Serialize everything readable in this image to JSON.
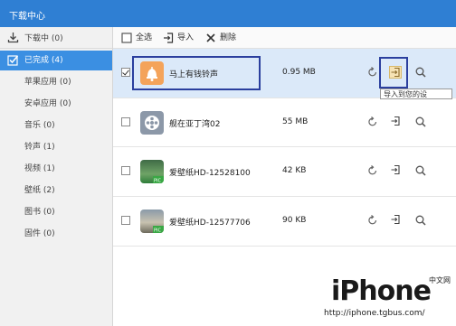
{
  "window": {
    "title": "下载中心"
  },
  "sidebar": {
    "downloading": "下载中 (0)",
    "done": "已完成 (4)",
    "categories": [
      "苹果应用 (0)",
      "安卓应用 (0)",
      "音乐 (0)",
      "铃声 (1)",
      "视频 (1)",
      "壁纸 (2)",
      "图书 (0)",
      "固件 (0)"
    ]
  },
  "toolbar": {
    "select_all": "全选",
    "import": "导入",
    "delete": "删除"
  },
  "files": [
    {
      "name": "马上有钱铃声",
      "size": "0.95 MB",
      "checked": true,
      "thumb": "bell-icon"
    },
    {
      "name": "舰在亚丁湾02",
      "size": "55 MB",
      "checked": false,
      "thumb": "film-reel-icon"
    },
    {
      "name": "爱壁纸HD-12528100",
      "size": "42 KB",
      "checked": false,
      "thumb": "wallpaper-pic-icon"
    },
    {
      "name": "爱壁纸HD-12577706",
      "size": "90 KB",
      "checked": false,
      "thumb": "wallpaper-pic-icon"
    }
  ],
  "tooltip": "导入到您的设",
  "watermark": {
    "brand": "iPhone",
    "cn": "中文网",
    "url": "http://iphone.tgbus.com/"
  },
  "colors": {
    "titlebar": "#2f7fd3",
    "sidebar_selected": "#3b8fe2",
    "row_selected": "#dbe9f9",
    "highlight_box": "#2b3f9e"
  }
}
